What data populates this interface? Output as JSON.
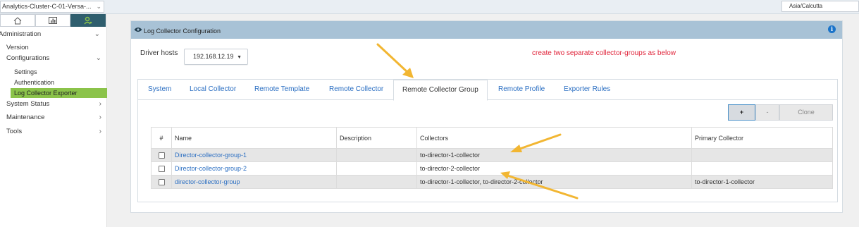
{
  "topbar": {
    "cluster_label": "Analytics-Cluster-C-01-Versa-...",
    "timezone": "Asia/Calcutta"
  },
  "sidebar": {
    "tabs": [
      {
        "icon": "home-icon"
      },
      {
        "icon": "bar-chart-icon"
      },
      {
        "icon": "user-settings-icon"
      }
    ],
    "section": "Administration",
    "items": {
      "version": "Version",
      "configurations": "Configurations",
      "settings": "Settings",
      "authentication": "Authentication",
      "log_collector_exporter": "Log Collector Exporter",
      "system_status": "System Status",
      "maintenance": "Maintenance",
      "tools": "Tools"
    }
  },
  "panel": {
    "title": "Log Collector Configuration",
    "driver_hosts_label": "Driver hosts",
    "driver_hosts_value": "192.168.12.19",
    "annotation": "create two separate collector-groups as below",
    "tabs": [
      "System",
      "Local Collector",
      "Remote Template",
      "Remote Collector",
      "Remote Collector Group",
      "Remote Profile",
      "Exporter Rules"
    ],
    "active_tab": "Remote Collector Group",
    "toolbar": {
      "add": "+",
      "remove": "-",
      "clone": "Clone"
    },
    "table": {
      "columns": [
        "#",
        "Name",
        "Description",
        "Collectors",
        "Primary Collector"
      ],
      "rows": [
        {
          "name": "Director-collector-group-1",
          "description": "",
          "collectors": "to-director-1-collector",
          "primary": ""
        },
        {
          "name": "Director-collector-group-2",
          "description": "",
          "collectors": "to-director-2-collector",
          "primary": ""
        },
        {
          "name": "director-collector-group",
          "description": "",
          "collectors": "to-director-1-collector, to-director-2-collector",
          "primary": "to-director-1-collector"
        }
      ]
    }
  },
  "colors": {
    "header_bar": "#a8c2d6",
    "active_nav": "#8bc34a",
    "link": "#2a6ec2",
    "annotation": "#e0243a",
    "arrow": "#f2b632"
  }
}
